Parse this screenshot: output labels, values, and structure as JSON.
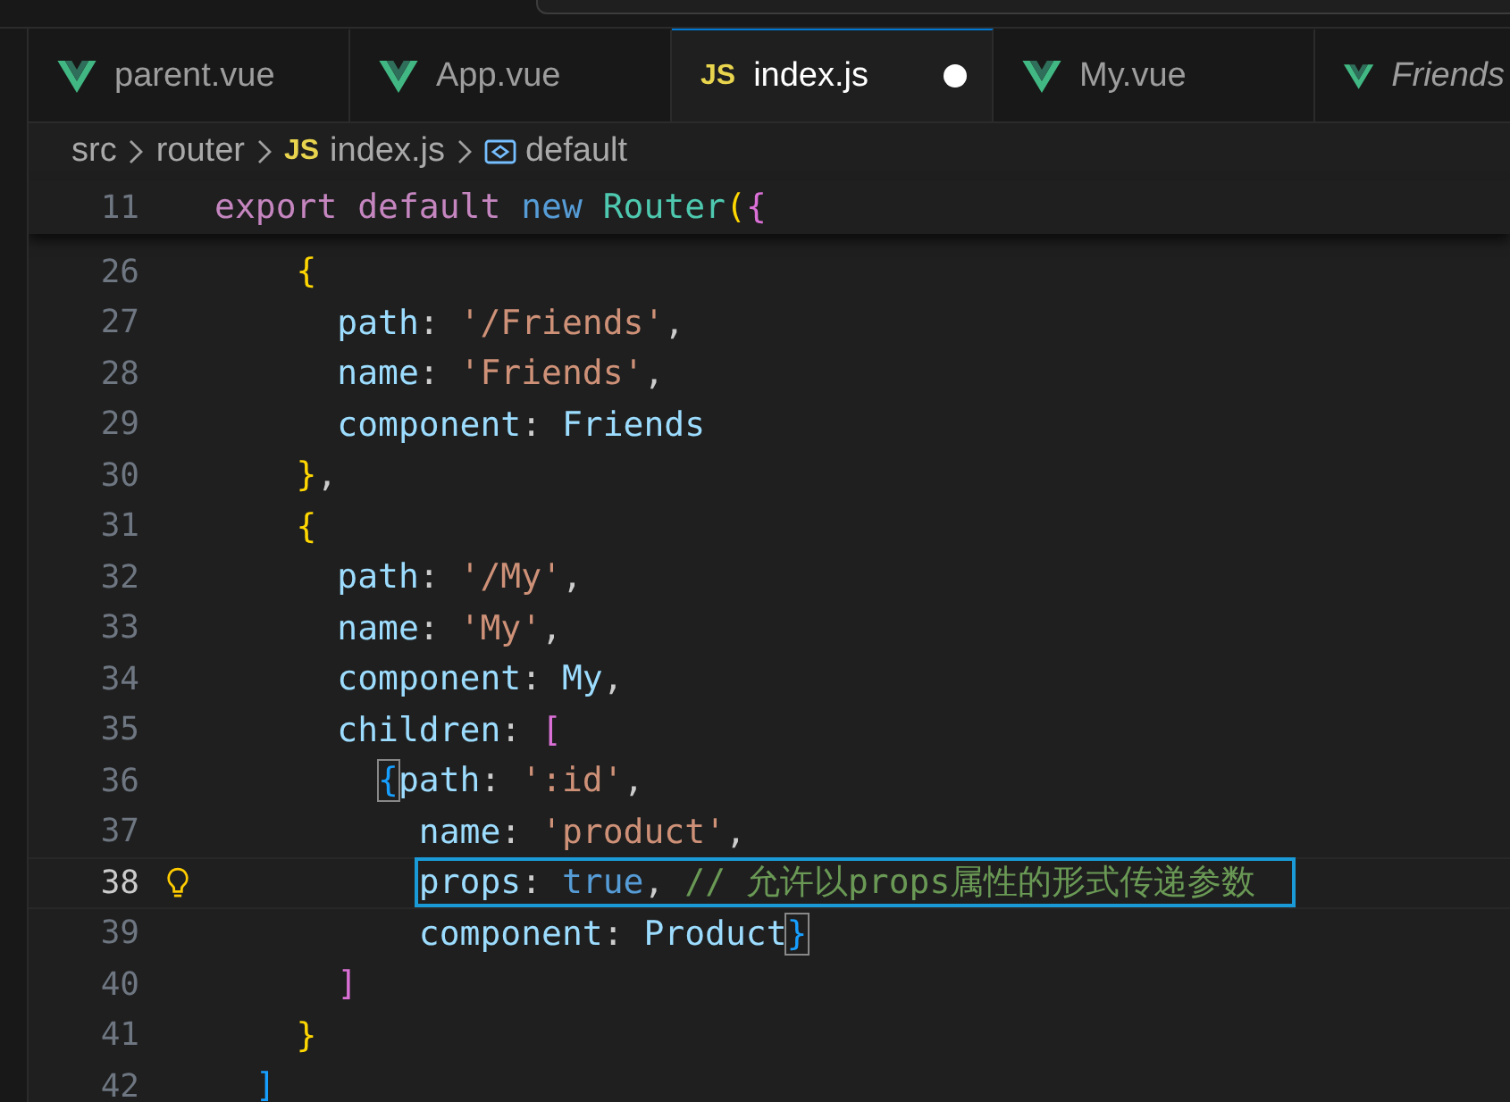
{
  "tabs": [
    {
      "label": "parent.vue",
      "kind": "vue",
      "selected": false,
      "dirty": false,
      "preview": false
    },
    {
      "label": "App.vue",
      "kind": "vue",
      "selected": false,
      "dirty": false,
      "preview": false
    },
    {
      "label": "index.js",
      "kind": "js",
      "badge": "JS",
      "selected": true,
      "dirty": true,
      "preview": false
    },
    {
      "label": "My.vue",
      "kind": "vue",
      "selected": false,
      "dirty": false,
      "preview": false
    },
    {
      "label": "Friends",
      "kind": "vue",
      "selected": false,
      "dirty": false,
      "preview": true
    }
  ],
  "breadcrumb": [
    {
      "label": "src",
      "kind": "folder"
    },
    {
      "label": "router",
      "kind": "folder"
    },
    {
      "label": "index.js",
      "kind": "js",
      "badge": "JS"
    },
    {
      "label": "default",
      "kind": "symbol"
    }
  ],
  "sticky_line": {
    "number": "11",
    "tokens": [
      {
        "t": "export default ",
        "kind": "keyword"
      },
      {
        "t": "new ",
        "kind": "storage"
      },
      {
        "t": "Router",
        "kind": "class"
      },
      {
        "t": "(",
        "kind": "bracket1"
      },
      {
        "t": "{",
        "kind": "bracket2"
      }
    ]
  },
  "lines": [
    {
      "number": "26",
      "current": false,
      "highlighted": false,
      "lightbulb": false,
      "tokens": [
        {
          "t": "    {",
          "kind": "bracket1"
        }
      ]
    },
    {
      "number": "27",
      "current": false,
      "highlighted": false,
      "lightbulb": false,
      "tokens": [
        {
          "t": "      path",
          "kind": "property"
        },
        {
          "t": ": ",
          "kind": "plain"
        },
        {
          "t": "'/Friends'",
          "kind": "string"
        },
        {
          "t": ",",
          "kind": "plain"
        }
      ]
    },
    {
      "number": "28",
      "current": false,
      "highlighted": false,
      "lightbulb": false,
      "tokens": [
        {
          "t": "      name",
          "kind": "property"
        },
        {
          "t": ": ",
          "kind": "plain"
        },
        {
          "t": "'Friends'",
          "kind": "string"
        },
        {
          "t": ",",
          "kind": "plain"
        }
      ]
    },
    {
      "number": "29",
      "current": false,
      "highlighted": false,
      "lightbulb": false,
      "tokens": [
        {
          "t": "      component",
          "kind": "property"
        },
        {
          "t": ": ",
          "kind": "plain"
        },
        {
          "t": "Friends",
          "kind": "property"
        }
      ]
    },
    {
      "number": "30",
      "current": false,
      "highlighted": false,
      "lightbulb": false,
      "tokens": [
        {
          "t": "    }",
          "kind": "bracket1"
        },
        {
          "t": ",",
          "kind": "plain"
        }
      ]
    },
    {
      "number": "31",
      "current": false,
      "highlighted": false,
      "lightbulb": false,
      "tokens": [
        {
          "t": "    {",
          "kind": "bracket1"
        }
      ]
    },
    {
      "number": "32",
      "current": false,
      "highlighted": false,
      "lightbulb": false,
      "tokens": [
        {
          "t": "      path",
          "kind": "property"
        },
        {
          "t": ": ",
          "kind": "plain"
        },
        {
          "t": "'/My'",
          "kind": "string"
        },
        {
          "t": ",",
          "kind": "plain"
        }
      ]
    },
    {
      "number": "33",
      "current": false,
      "highlighted": false,
      "lightbulb": false,
      "tokens": [
        {
          "t": "      name",
          "kind": "property"
        },
        {
          "t": ": ",
          "kind": "plain"
        },
        {
          "t": "'My'",
          "kind": "string"
        },
        {
          "t": ",",
          "kind": "plain"
        }
      ]
    },
    {
      "number": "34",
      "current": false,
      "highlighted": false,
      "lightbulb": false,
      "tokens": [
        {
          "t": "      component",
          "kind": "property"
        },
        {
          "t": ": ",
          "kind": "plain"
        },
        {
          "t": "My",
          "kind": "property"
        },
        {
          "t": ",",
          "kind": "plain"
        }
      ]
    },
    {
      "number": "35",
      "current": false,
      "highlighted": false,
      "lightbulb": false,
      "tokens": [
        {
          "t": "      children",
          "kind": "property"
        },
        {
          "t": ": ",
          "kind": "plain"
        },
        {
          "t": "[",
          "kind": "bracket2"
        }
      ]
    },
    {
      "number": "36",
      "current": false,
      "highlighted": false,
      "lightbulb": false,
      "tokens": [
        {
          "t": "        {",
          "kind": "match"
        },
        {
          "t": "path",
          "kind": "property"
        },
        {
          "t": ": ",
          "kind": "plain"
        },
        {
          "t": "':id'",
          "kind": "string"
        },
        {
          "t": ",",
          "kind": "plain"
        }
      ]
    },
    {
      "number": "37",
      "current": false,
      "highlighted": false,
      "lightbulb": false,
      "tokens": [
        {
          "t": "          name",
          "kind": "property"
        },
        {
          "t": ": ",
          "kind": "plain"
        },
        {
          "t": "'product'",
          "kind": "string"
        },
        {
          "t": ",",
          "kind": "plain"
        }
      ]
    },
    {
      "number": "38",
      "current": true,
      "highlighted": true,
      "lightbulb": true,
      "tokens": [
        {
          "t": "          props",
          "kind": "property"
        },
        {
          "t": ": ",
          "kind": "plain"
        },
        {
          "t": "true",
          "kind": "storage"
        },
        {
          "t": ", ",
          "kind": "plain"
        },
        {
          "t": "// 允许以props属性的形式传递参数",
          "kind": "comment"
        }
      ]
    },
    {
      "number": "39",
      "current": false,
      "highlighted": false,
      "lightbulb": false,
      "tokens": [
        {
          "t": "          component",
          "kind": "property"
        },
        {
          "t": ": ",
          "kind": "plain"
        },
        {
          "t": "Product",
          "kind": "property"
        },
        {
          "t": "}",
          "kind": "match"
        }
      ]
    },
    {
      "number": "40",
      "current": false,
      "highlighted": false,
      "lightbulb": false,
      "tokens": [
        {
          "t": "      ]",
          "kind": "bracket2"
        }
      ]
    },
    {
      "number": "41",
      "current": false,
      "highlighted": false,
      "lightbulb": false,
      "tokens": [
        {
          "t": "    }",
          "kind": "bracket1"
        }
      ]
    },
    {
      "number": "42",
      "current": false,
      "highlighted": false,
      "lightbulb": false,
      "tokens": [
        {
          "t": "  ]",
          "kind": "bracket3"
        }
      ]
    }
  ]
}
